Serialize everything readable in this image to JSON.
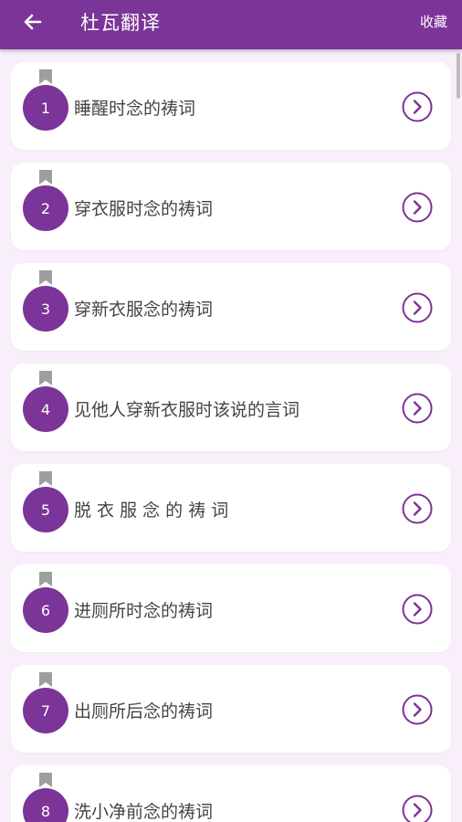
{
  "app": {
    "title": "杜瓦翻译",
    "favorites_label": "收藏",
    "accent_color": "#7b3497",
    "background_color": "#f8effb"
  },
  "items": [
    {
      "number": "1",
      "label": "睡醒时念的祷词"
    },
    {
      "number": "2",
      "label": "穿衣服时念的祷词"
    },
    {
      "number": "3",
      "label": "穿新衣服念的祷词"
    },
    {
      "number": "4",
      "label": "见他人穿新衣服时该说的言词"
    },
    {
      "number": "5",
      "label": "脱 衣 服 念 的 祷 词"
    },
    {
      "number": "6",
      "label": "进厕所时念的祷词"
    },
    {
      "number": "7",
      "label": "出厕所后念的祷词"
    },
    {
      "number": "8",
      "label": "洗小净前念的祷词"
    }
  ],
  "icons": {
    "back": "arrow-left-icon",
    "bookmark": "bookmark-icon",
    "open": "chevron-right-circle-icon"
  }
}
